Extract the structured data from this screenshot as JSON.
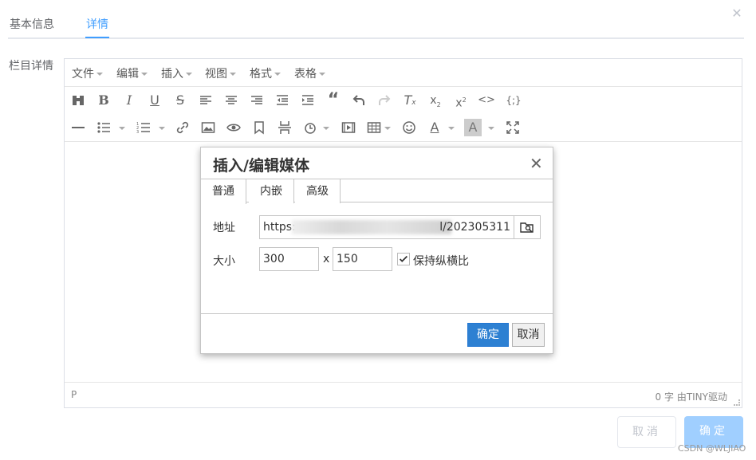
{
  "tabs": [
    {
      "label": "基本信息"
    },
    {
      "label": "详情"
    }
  ],
  "field_label": "栏目详情",
  "menubar": {
    "items": [
      {
        "label": "文件"
      },
      {
        "label": "编辑"
      },
      {
        "label": "插入"
      },
      {
        "label": "视图"
      },
      {
        "label": "格式"
      },
      {
        "label": "表格"
      }
    ]
  },
  "status": {
    "path": "P",
    "wordcount": "0 字",
    "powered": "由TINY驱动"
  },
  "dialog": {
    "title": "插入/编辑媒体",
    "tabs": [
      {
        "label": "普通"
      },
      {
        "label": "内嵌"
      },
      {
        "label": "高级"
      }
    ],
    "source_label": "地址",
    "source_prefix": "https:",
    "source_suffix": "l/202305311",
    "size_label": "大小",
    "width": "300",
    "x_sep": "x",
    "height": "150",
    "constrain_label": "保持纵横比",
    "constrain_checked": true,
    "ok_label": "确定",
    "cancel_label": "取消"
  },
  "footer": {
    "cancel_label": "取消",
    "ok_label": "确定"
  },
  "watermark": "CSDN @WLJIAO",
  "colors": {
    "accent": "#409eff",
    "dialog_ok": "#2d80d2",
    "footer_ok": "#a0cfff"
  }
}
